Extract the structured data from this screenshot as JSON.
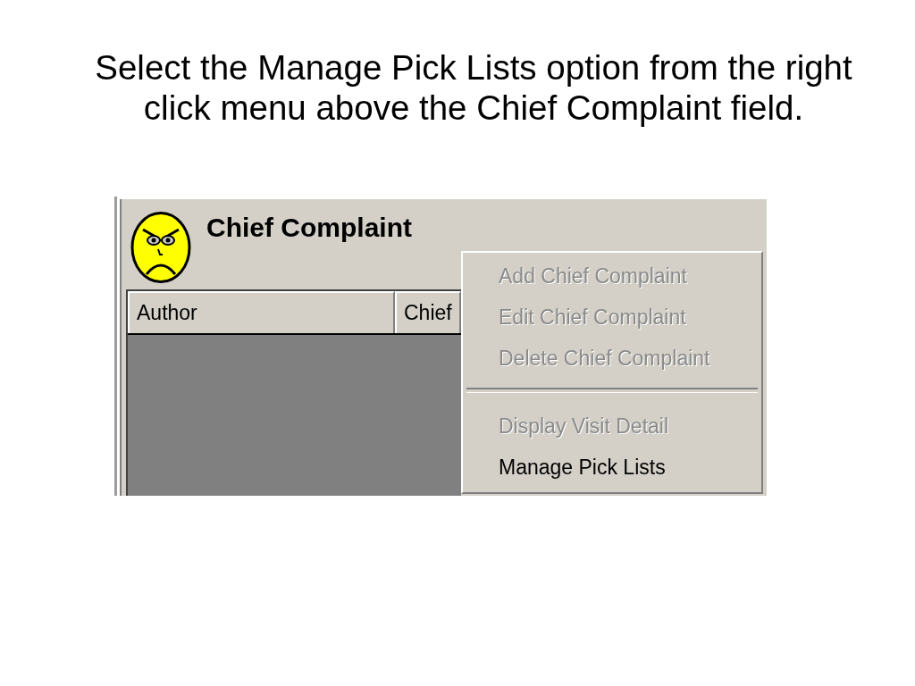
{
  "instruction": "Select the Manage Pick Lists option from the right click menu above the Chief Complaint field.",
  "panel": {
    "title": "Chief Complaint",
    "table": {
      "columns": [
        {
          "label": "Author"
        },
        {
          "label": "Chief"
        }
      ]
    }
  },
  "context_menu": {
    "groups": [
      {
        "items": [
          {
            "label": "Add Chief Complaint",
            "disabled": true
          },
          {
            "label": "Edit Chief Complaint",
            "disabled": true
          },
          {
            "label": "Delete Chief Complaint",
            "disabled": true
          }
        ]
      },
      {
        "items": [
          {
            "label": "Display Visit Detail",
            "disabled": true
          },
          {
            "label": "Manage Pick Lists",
            "disabled": false
          }
        ]
      }
    ]
  }
}
